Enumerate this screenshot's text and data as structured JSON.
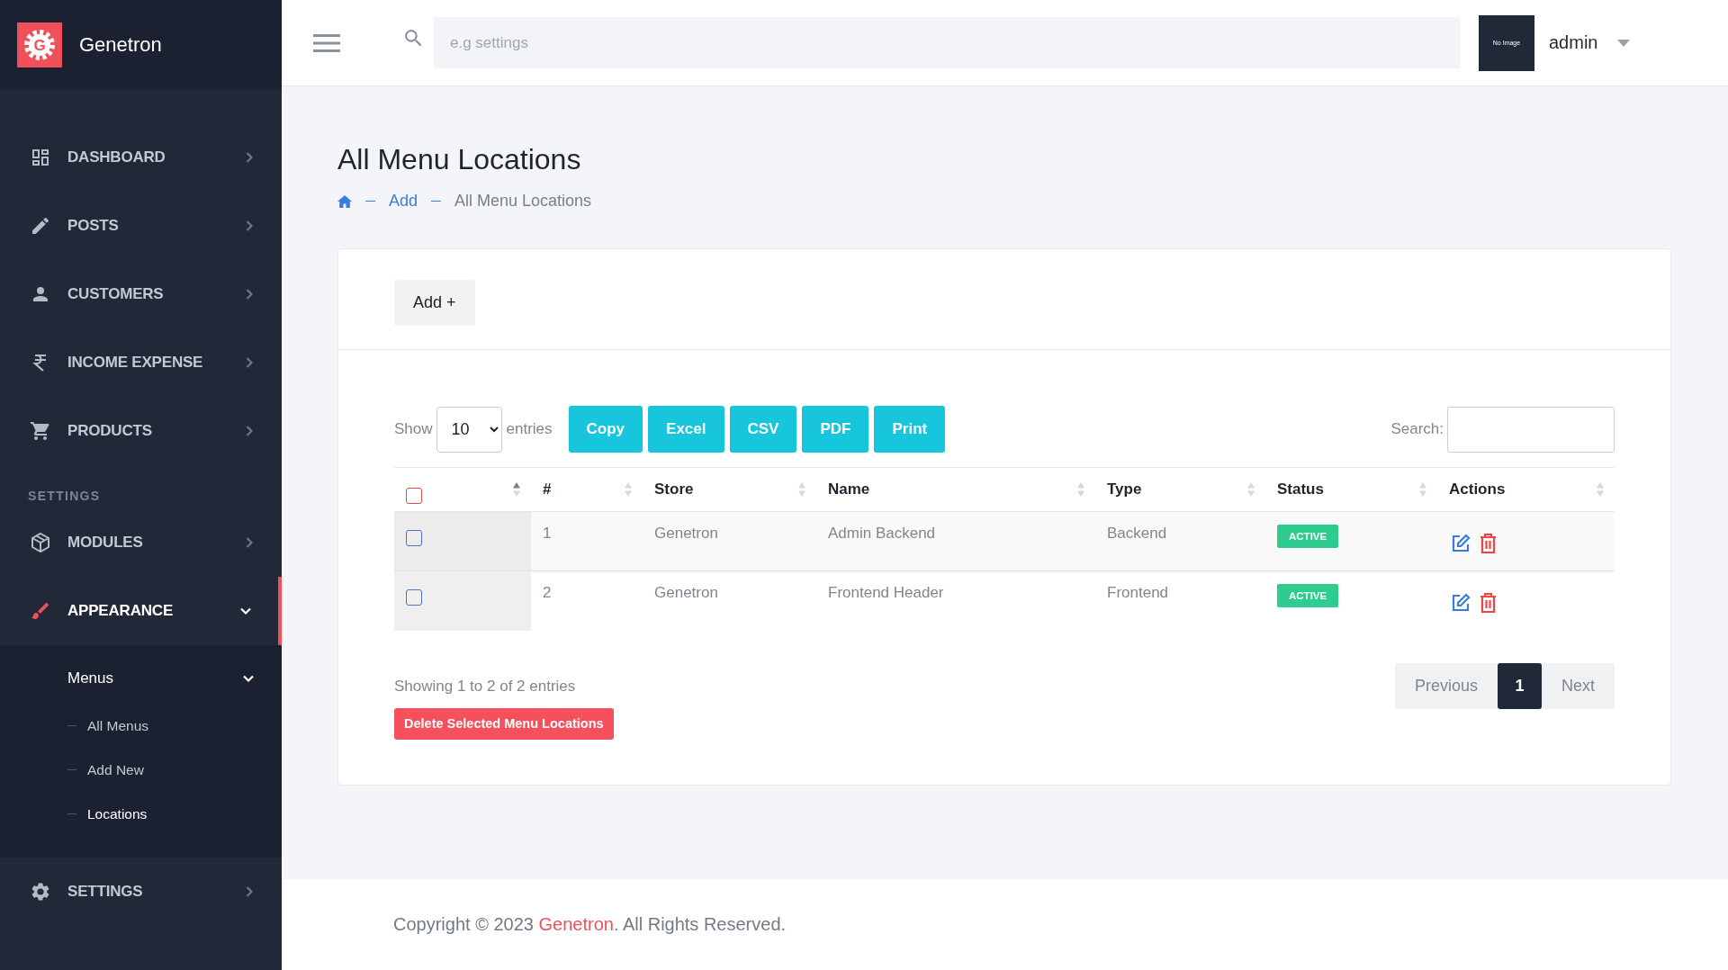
{
  "brand": {
    "name": "Genetron",
    "logo_letter": "G"
  },
  "sidebar": {
    "items": [
      {
        "kind": "item",
        "label": "DASHBOARD",
        "selected": false,
        "expanded": false
      },
      {
        "kind": "item",
        "label": "POSTS",
        "selected": false,
        "expanded": false
      },
      {
        "kind": "item",
        "label": "CUSTOMERS",
        "selected": false,
        "expanded": false
      },
      {
        "kind": "item",
        "label": "INCOME EXPENSE",
        "selected": false,
        "expanded": false
      },
      {
        "kind": "item",
        "label": "PRODUCTS",
        "selected": false,
        "expanded": false
      },
      {
        "kind": "heading",
        "label": "SETTINGS"
      },
      {
        "kind": "item",
        "label": "MODULES",
        "selected": false,
        "expanded": false
      },
      {
        "kind": "item",
        "label": "APPEARANCE",
        "selected": true,
        "expanded": true,
        "children": [
          {
            "label": "Menus",
            "expanded": true,
            "children": [
              {
                "label": "All Menus",
                "selected": false
              },
              {
                "label": "Add New",
                "selected": false
              },
              {
                "label": "Locations",
                "selected": true
              }
            ]
          }
        ]
      },
      {
        "kind": "item",
        "label": "SETTINGS",
        "selected": false,
        "expanded": false
      }
    ]
  },
  "header": {
    "search": {
      "placeholder": "e.g settings"
    },
    "avatar_text": "No Image",
    "user": "admin"
  },
  "page": {
    "title": "All Menu Locations",
    "breadcrumb": [
      "Add",
      "All Menu Locations"
    ]
  },
  "card": {
    "add_button": "Add +",
    "controls": {
      "show_label": "Show",
      "page_size": "10",
      "entries_label": "entries",
      "export_buttons": [
        "Copy",
        "Excel",
        "CSV",
        "PDF",
        "Print"
      ],
      "search_label": "Search:"
    },
    "table": {
      "select_all": {
        "checked": false,
        "sorted_ascending": true
      },
      "columns": [
        {
          "label": "#",
          "sorted_ascending": false
        },
        {
          "label": "Store",
          "sorted_ascending": false
        },
        {
          "label": "Name",
          "sorted_ascending": false
        },
        {
          "label": "Type",
          "sorted_ascending": false
        },
        {
          "label": "Status",
          "sorted_ascending": false
        },
        {
          "label": "Actions",
          "sorted_ascending": false
        }
      ],
      "rows": [
        {
          "checked": false,
          "cells": [
            "1",
            "Genetron",
            "Admin Backend",
            "Backend"
          ],
          "status": "ACTIVE"
        },
        {
          "checked": false,
          "cells": [
            "2",
            "Genetron",
            "Frontend Header",
            "Frontend"
          ],
          "status": "ACTIVE"
        }
      ]
    },
    "info": "Showing 1 to 2 of 2 entries",
    "delete_button": "Delete Selected Menu Locations",
    "pagination": {
      "previous": "Previous",
      "next": "Next",
      "pages": [
        {
          "label": "1",
          "selected": true
        }
      ]
    }
  },
  "footer": {
    "prefix": "Copyright © 2023 ",
    "brand": "Genetron",
    "suffix": ". All Rights Reserved."
  }
}
